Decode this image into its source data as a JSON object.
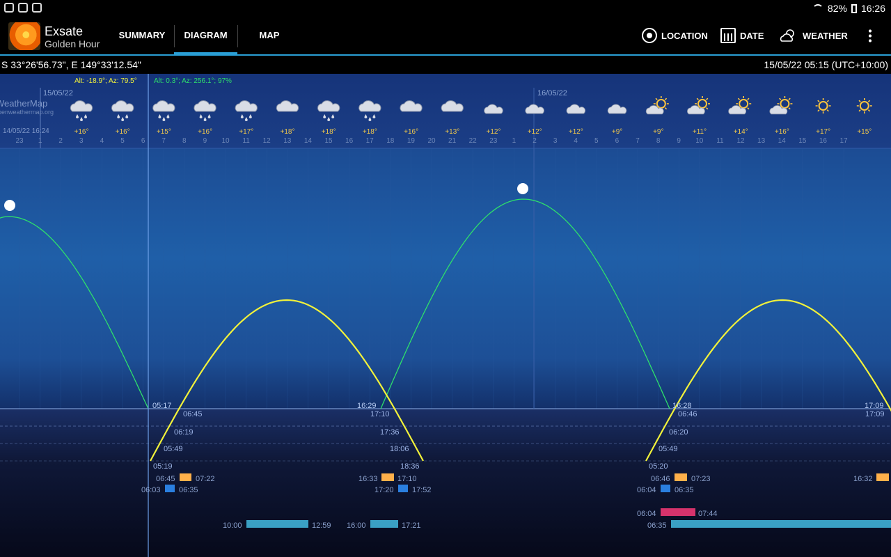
{
  "status": {
    "battery": "82%",
    "time": "16:26"
  },
  "app": {
    "title": "Exsate",
    "subtitle": "Golden Hour"
  },
  "tabs": [
    {
      "label": "SUMMARY"
    },
    {
      "label": "DIAGRAM"
    },
    {
      "label": "MAP"
    }
  ],
  "actions": {
    "location": "LOCATION",
    "date": "DATE",
    "weather": "WEATHER"
  },
  "info": {
    "coords": "S 33°26'56.73\", E 149°33'12.54\"",
    "datetime": "15/05/22 05:15 (UTC+10:00)"
  },
  "readout": {
    "sun": "Alt: -18.9°; Az: 79.5°",
    "moon": "Alt: 0.3°; Az: 256.1°; 97%"
  },
  "weather_source": {
    "name": "WeatherMap",
    "site": "openweathermap.org",
    "updated": "14/05/22 16:24"
  },
  "day_labels": [
    "15/05/22",
    "16/05/22"
  ],
  "forecast": [
    {
      "icon": "rain-icon",
      "temp": "+16°"
    },
    {
      "icon": "rain-icon",
      "temp": "+16°"
    },
    {
      "icon": "rain-icon",
      "temp": "+15°"
    },
    {
      "icon": "rain-icon",
      "temp": "+16°"
    },
    {
      "icon": "rain-icon",
      "temp": "+17°"
    },
    {
      "icon": "cloud-icon",
      "temp": "+18°"
    },
    {
      "icon": "rain-icon",
      "temp": "+18°"
    },
    {
      "icon": "rain-icon",
      "temp": "+18°"
    },
    {
      "icon": "cloud-icon",
      "temp": "+16°"
    },
    {
      "icon": "cloud-icon",
      "temp": "+13°"
    },
    {
      "icon": "cloud-night-icon",
      "temp": "+12°"
    },
    {
      "icon": "cloud-night-icon",
      "temp": "+12°"
    },
    {
      "icon": "cloud-night-icon",
      "temp": "+12°"
    },
    {
      "icon": "cloud-night-icon",
      "temp": "+9°"
    },
    {
      "icon": "sun-cloud-icon",
      "temp": "+9°"
    },
    {
      "icon": "sun-cloud-icon",
      "temp": "+11°"
    },
    {
      "icon": "sun-cloud-icon",
      "temp": "+14°"
    },
    {
      "icon": "sun-cloud-icon",
      "temp": "+16°"
    },
    {
      "icon": "sun-icon",
      "temp": "+17°"
    },
    {
      "icon": "sun-icon",
      "temp": "+15°"
    }
  ],
  "hour_ticks": [
    "23",
    "1",
    "2",
    "3",
    "4",
    "5",
    "6",
    "7",
    "8",
    "9",
    "10",
    "11",
    "12",
    "13",
    "14",
    "15",
    "16",
    "17",
    "18",
    "19",
    "20",
    "21",
    "22",
    "23",
    "1",
    "2",
    "3",
    "4",
    "5",
    "6",
    "7",
    "8",
    "9",
    "10",
    "11",
    "12",
    "13",
    "14",
    "15",
    "16",
    "17"
  ],
  "curve_labels": {
    "sunrise_1": "05:17",
    "moonset_1": "16:29",
    "sunrise_2": "16:28",
    "sunset_2": "17:09",
    "golden_morning_end_1": "06:45",
    "blue_morning_1": "06:19",
    "civil_1": "05:49",
    "astro_1": "05:19",
    "golden_evening_1": "17:10",
    "blue_evening_1": "17:36",
    "civil_evening_1": "18:06",
    "astro_evening_1": "18:36",
    "golden_morning_end_2": "06:46",
    "blue_morning_2": "06:20",
    "civil_2": "05:49",
    "astro_2": "05:20",
    "golden_evening_2": "17:09"
  },
  "bars": {
    "golden_1": {
      "start": "06:45",
      "end": "07:22"
    },
    "blue_1": {
      "start": "06:03",
      "end": "06:35"
    },
    "golden_evening_1": {
      "start": "16:33",
      "end": "17:10"
    },
    "blue_evening_1": {
      "start": "17:20",
      "end": "17:52"
    },
    "golden_2": {
      "start": "06:46",
      "end": "07:23"
    },
    "blue_2": {
      "start": "06:04",
      "end": "06:35"
    },
    "golden_evening_2": {
      "start": "16:32"
    },
    "moon_1": {
      "start": "10:00",
      "end": "12:59"
    },
    "moon_2": {
      "start": "16:00",
      "end": "17:21"
    },
    "red_2": {
      "start": "06:04",
      "end": "07:44"
    },
    "moon_3": {
      "start": "06:35"
    }
  },
  "colors": {
    "sun": "#f2f23a",
    "moon": "#2ee06b",
    "golden": "#ffb04a",
    "blue": "#2a7fe0",
    "moonbar": "#3aa0c4",
    "red": "#d6336c",
    "accent": "#2a9fd6"
  }
}
